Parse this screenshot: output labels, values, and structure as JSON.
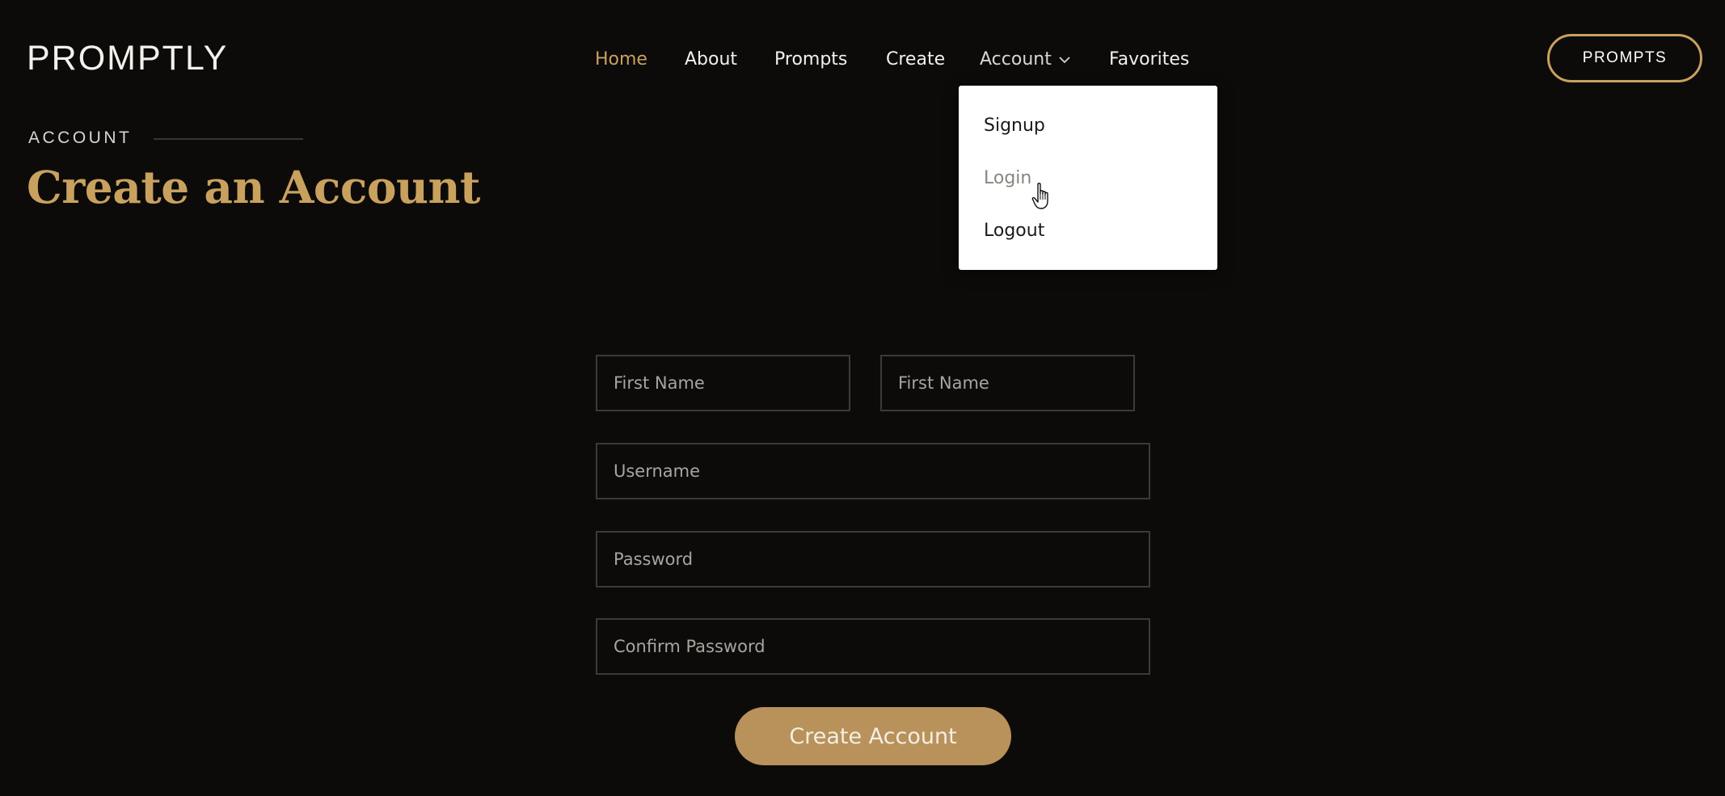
{
  "brand": {
    "logo": "PROMPTLY"
  },
  "nav": {
    "items": [
      {
        "label": "Home"
      },
      {
        "label": "About"
      },
      {
        "label": "Prompts"
      },
      {
        "label": "Create"
      },
      {
        "label": "Account"
      },
      {
        "label": "Favorites"
      }
    ]
  },
  "cta": {
    "label": "PROMPTS"
  },
  "account_menu": {
    "items": [
      {
        "label": "Signup"
      },
      {
        "label": "Login"
      },
      {
        "label": "Logout"
      }
    ]
  },
  "header": {
    "eyebrow": "ACCOUNT",
    "title": "Create an Account"
  },
  "form": {
    "first_name_placeholder": "First Name",
    "last_name_placeholder": "First Name",
    "username_placeholder": "Username",
    "password_placeholder": "Password",
    "confirm_password_placeholder": "Confirm Password",
    "submit_label": "Create Account"
  },
  "colors": {
    "background": "#0d0b0a",
    "accent": "#c9a15e",
    "button": "#b8925a"
  },
  "icons": [
    "chevron-down-icon",
    "hand-pointer-icon"
  ]
}
